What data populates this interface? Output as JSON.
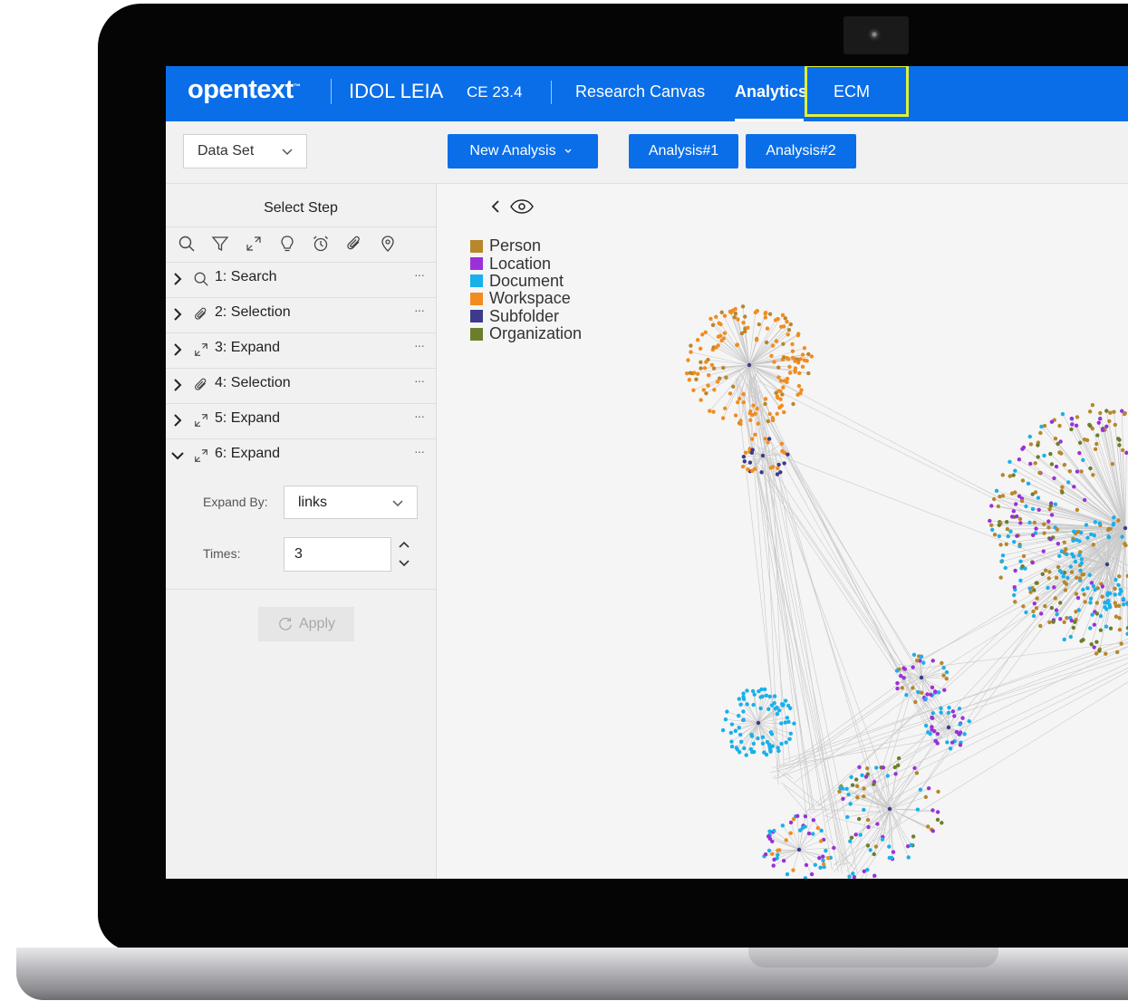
{
  "app": {
    "logo": "opentext",
    "product": "IDOL LEIA",
    "version": "CE 23.4",
    "nav": [
      {
        "label": "Research Canvas"
      },
      {
        "label": "Analytics",
        "active": true
      },
      {
        "label": "ECM",
        "highlighted": true
      }
    ]
  },
  "toolbar": {
    "dataset_label": "Data Set",
    "new_analysis_label": "New Analysis",
    "analysis_tabs": [
      "Analysis#1",
      "Analysis#2"
    ]
  },
  "sidebar": {
    "title": "Select Step",
    "tools": [
      "search-icon",
      "filter-icon",
      "expand-icon",
      "lightbulb-icon",
      "alarm-icon",
      "paperclip-icon",
      "location-pin-icon"
    ],
    "steps": [
      {
        "label": "1: Search",
        "icon": "search-icon",
        "expanded": false
      },
      {
        "label": "2: Selection",
        "icon": "paperclip-icon",
        "expanded": false
      },
      {
        "label": "3: Expand",
        "icon": "expand-icon",
        "expanded": false
      },
      {
        "label": "4: Selection",
        "icon": "paperclip-icon",
        "expanded": false
      },
      {
        "label": "5: Expand",
        "icon": "expand-icon",
        "expanded": false
      },
      {
        "label": "6: Expand",
        "icon": "expand-icon",
        "expanded": true
      }
    ],
    "more_label": "···",
    "expand_by_label": "Expand By:",
    "expand_by_value": "links",
    "times_label": "Times:",
    "times_value": "3",
    "apply_label": "Apply"
  },
  "legend": [
    {
      "label": "Person",
      "color": "#b8862b"
    },
    {
      "label": "Location",
      "color": "#9b30d9"
    },
    {
      "label": "Document",
      "color": "#1ab0ea"
    },
    {
      "label": "Workspace",
      "color": "#f28c1e"
    },
    {
      "label": "Subfolder",
      "color": "#3d3a8c"
    },
    {
      "label": "Organization",
      "color": "#6b7e2b"
    }
  ],
  "colors": {
    "brand_blue": "#0a6ee8",
    "ecm_highlight": "#e1f03a"
  }
}
